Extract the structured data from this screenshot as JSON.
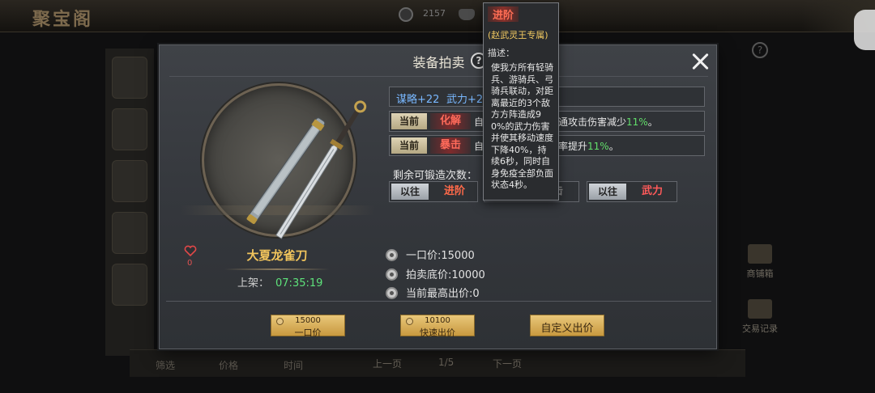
{
  "background": {
    "page_title": "聚宝阁",
    "currency_value": "2157",
    "right_items": [
      "商铺箱",
      "交易记录"
    ],
    "filters": [
      "筛选",
      "价格",
      "时间"
    ],
    "pager": {
      "prev": "上一页",
      "page": "1/5",
      "next": "下一页"
    }
  },
  "dialog": {
    "title": "装备拍卖",
    "help": "?",
    "item": {
      "name": "大夏龙雀刀",
      "likes": "0",
      "listed_label": "上架：",
      "listed_time": "07:35:19"
    },
    "stats": {
      "intel": "谋略+22",
      "force": "武力+20"
    },
    "current_skills": [
      {
        "tag": "当前",
        "skill": "化解",
        "desc_prefix": "自",
        "desc_main": "通攻击伤害减少",
        "pct": "11%",
        "suffix": "。"
      },
      {
        "tag": "当前",
        "skill": "暴击",
        "desc_prefix": "自",
        "desc_main": "率提升",
        "pct": "11%",
        "suffix": "。"
      }
    ],
    "forge_label": "剩余可锻造次数：",
    "past_skills": [
      {
        "tag": "以往",
        "skill": "进阶",
        "color": "#ff6a4a"
      },
      {
        "tag": "",
        "skill": "攻击",
        "color": "#8a8a8a"
      },
      {
        "tag": "以往",
        "skill": "武力",
        "color": "#ff5a5a"
      }
    ],
    "prices": {
      "buyout": "一口价:15000",
      "reserve": "拍卖底价:10000",
      "highest": "当前最高出价:0"
    },
    "buttons": {
      "buyout_price": "15000",
      "buyout_label": "一口价",
      "quick_price": "10100",
      "quick_label": "快速出价",
      "custom_label": "自定义出价"
    }
  },
  "tooltip": {
    "skill": "进阶",
    "exclusive": "(赵武灵王专属)",
    "desc_label": "描述：",
    "desc": "使我方所有轻骑兵、游骑兵、弓骑兵联动，对距离最近的3个敌方方阵造成90%的武力伤害并使其移动速度下降40%，持续6秒，同时自身免疫全部负面状态4秒。"
  },
  "colors": {
    "gold": "#f1c45c",
    "green": "#5ee27a",
    "stat_blue": "#79b8ff",
    "skill_red": "#ff6a5a"
  }
}
